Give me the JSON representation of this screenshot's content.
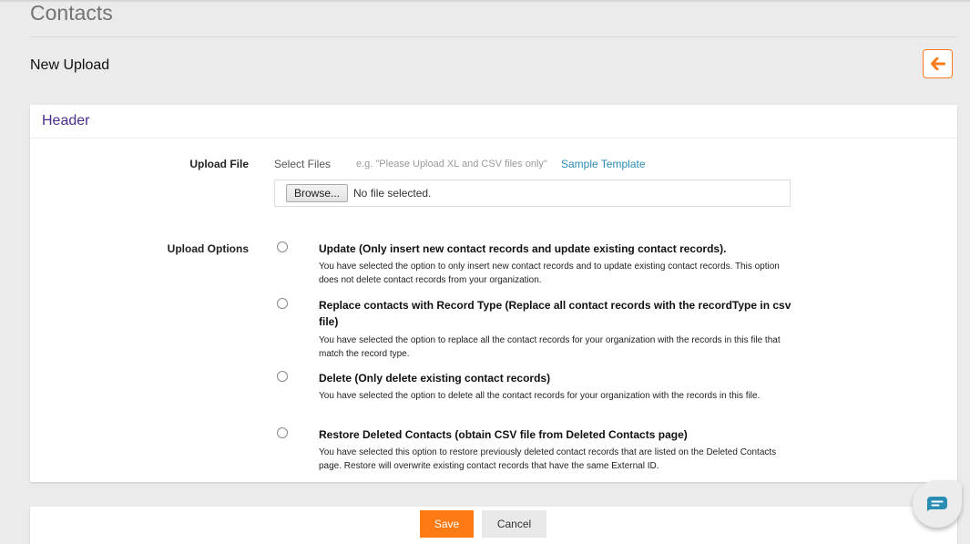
{
  "page": {
    "title": "Contacts",
    "subtitle": "New Upload",
    "back_icon": "arrow-left-icon"
  },
  "card": {
    "header": "Header",
    "upload_file": {
      "label": "Upload File",
      "select_files": "Select Files",
      "hint": "e.g. \"Please Upload XL and CSV files only\"",
      "sample_link": "Sample Template",
      "browse_label": "Browse...",
      "file_status": "No file selected."
    },
    "upload_options": {
      "label": "Upload Options",
      "options": [
        {
          "title": "Update (Only insert new contact records and update existing contact records).",
          "description": "You have selected the option to only insert new contact records and to update existing contact records. This option does not delete contact records from your organization.",
          "selected": false
        },
        {
          "title": "Replace contacts with Record Type (Replace all contact records with the recordType in csv file)",
          "description": "You have selected the option to replace all the contact records for your organization with the records in this file that match the record type.",
          "selected": false
        },
        {
          "title": "Delete (Only delete existing contact records)",
          "description": "You have selected the option to delete all the contact records for your organization with the records in this file.",
          "selected": false
        },
        {
          "title": "Restore Deleted Contacts (obtain CSV file from Deleted Contacts page)",
          "description": "You have selected this option to restore previously deleted contact records that are listed on the Deleted Contacts page. Restore will overwrite existing contact records that have the same External ID.",
          "selected": false
        }
      ]
    }
  },
  "footer": {
    "save_label": "Save",
    "cancel_label": "Cancel"
  },
  "chat": {
    "icon": "chat-icon"
  },
  "colors": {
    "accent": "#ff7a12",
    "header_text": "#4b2c8f",
    "link": "#2b8ab0",
    "chat": "#2a8db3"
  }
}
